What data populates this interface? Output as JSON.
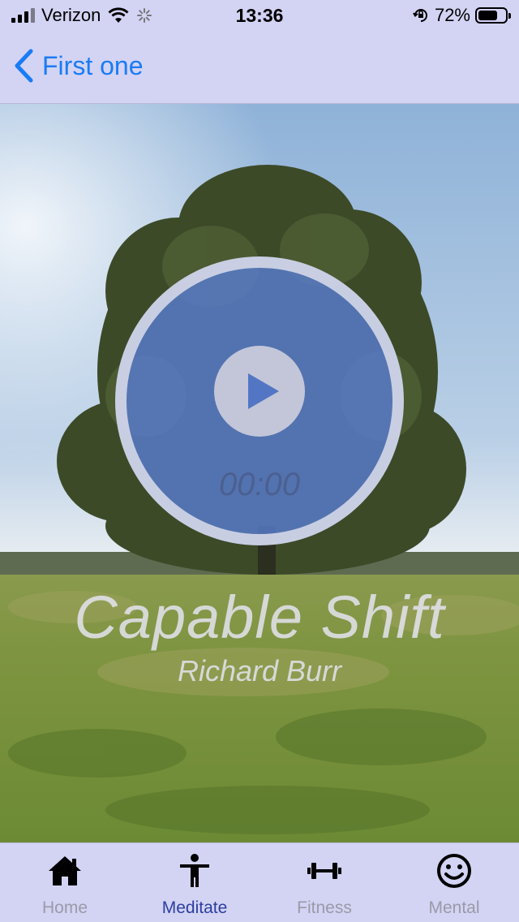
{
  "status_bar": {
    "carrier": "Verizon",
    "time": "13:36",
    "battery_percent": "72%",
    "battery_level": 0.72
  },
  "nav": {
    "back_label": "First one"
  },
  "player": {
    "timer": "00:00",
    "title": "Capable Shift",
    "artist": "Richard Burr"
  },
  "tabs": [
    {
      "label": "Home",
      "icon": "house-icon"
    },
    {
      "label": "Meditate",
      "icon": "person-icon"
    },
    {
      "label": "Fitness",
      "icon": "dumbbell-icon"
    },
    {
      "label": "Mental",
      "icon": "smiley-icon"
    }
  ],
  "active_tab": "Meditate",
  "colors": {
    "bar_background": "#d3d3f4",
    "accent_blue": "#1a7cf5",
    "active_tab": "#2b3f9e",
    "inactive_tab": "#9a9aa8"
  }
}
